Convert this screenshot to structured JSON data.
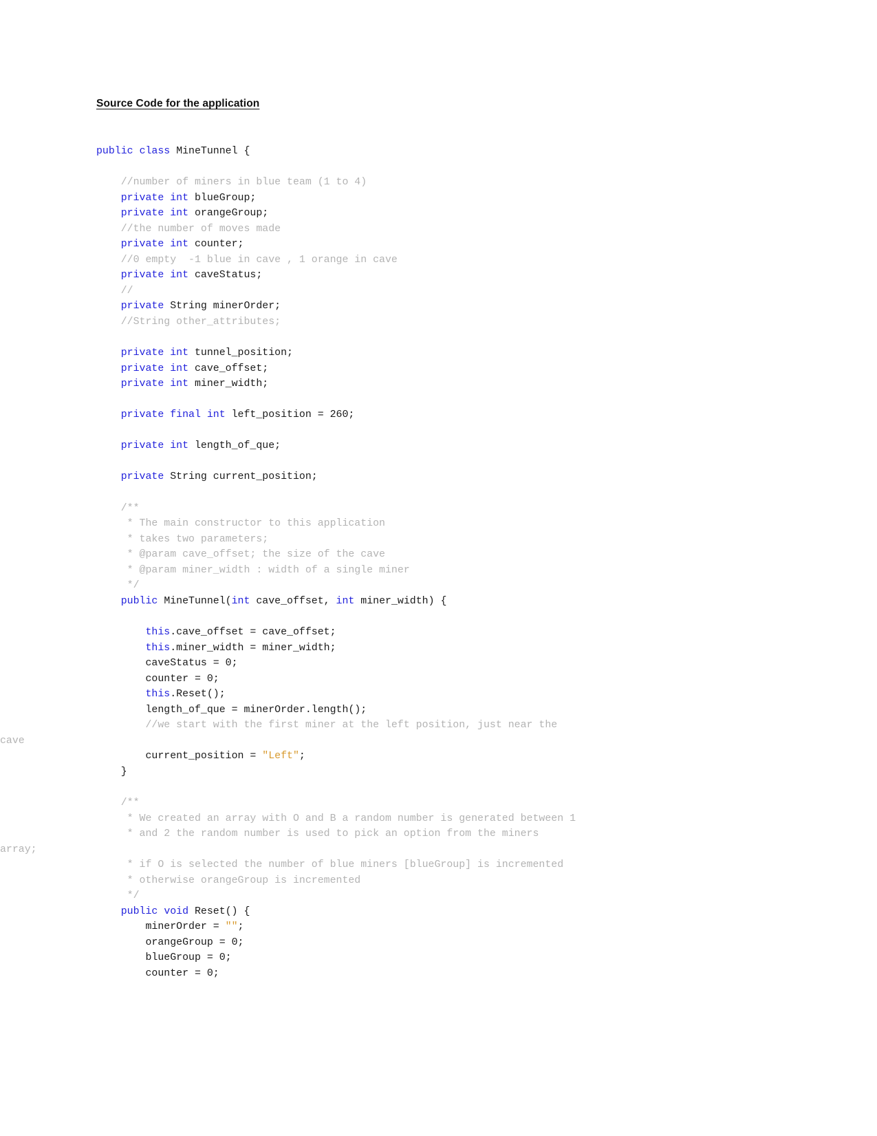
{
  "document": {
    "heading": "Source Code for the application",
    "language": "java",
    "colors": {
      "keyword": "#2323DC",
      "comment": "#B3B3B3",
      "string": "#D89A2E",
      "text": "#1A1A1A",
      "background": "#FFFFFF"
    },
    "code_lines": [
      {
        "id": "l1",
        "indent": 0,
        "wrapped": false,
        "tokens": [
          {
            "t": "public ",
            "c": "kw"
          },
          {
            "t": "class ",
            "c": "kw"
          },
          {
            "t": "MineTunnel {",
            "c": "plain"
          }
        ]
      },
      {
        "id": "l2",
        "indent": 0,
        "wrapped": false,
        "tokens": []
      },
      {
        "id": "l3",
        "indent": 1,
        "wrapped": false,
        "tokens": [
          {
            "t": "//number of miners in blue team (1 to 4)",
            "c": "cmt"
          }
        ]
      },
      {
        "id": "l4",
        "indent": 1,
        "wrapped": false,
        "tokens": [
          {
            "t": "private ",
            "c": "kw"
          },
          {
            "t": "int ",
            "c": "kw"
          },
          {
            "t": "blueGroup;",
            "c": "plain"
          }
        ]
      },
      {
        "id": "l5",
        "indent": 1,
        "wrapped": false,
        "tokens": [
          {
            "t": "private ",
            "c": "kw"
          },
          {
            "t": "int ",
            "c": "kw"
          },
          {
            "t": "orangeGroup;",
            "c": "plain"
          }
        ]
      },
      {
        "id": "l6",
        "indent": 1,
        "wrapped": false,
        "tokens": [
          {
            "t": "//the number of moves made",
            "c": "cmt"
          }
        ]
      },
      {
        "id": "l7",
        "indent": 1,
        "wrapped": false,
        "tokens": [
          {
            "t": "private ",
            "c": "kw"
          },
          {
            "t": "int ",
            "c": "kw"
          },
          {
            "t": "counter;",
            "c": "plain"
          }
        ]
      },
      {
        "id": "l8",
        "indent": 1,
        "wrapped": false,
        "tokens": [
          {
            "t": "//0 empty  -1 blue in cave , 1 orange in cave",
            "c": "cmt"
          }
        ]
      },
      {
        "id": "l9",
        "indent": 1,
        "wrapped": false,
        "tokens": [
          {
            "t": "private ",
            "c": "kw"
          },
          {
            "t": "int ",
            "c": "kw"
          },
          {
            "t": "caveStatus;",
            "c": "plain"
          }
        ]
      },
      {
        "id": "l10",
        "indent": 1,
        "wrapped": false,
        "tokens": [
          {
            "t": "//",
            "c": "cmt"
          }
        ]
      },
      {
        "id": "l11",
        "indent": 1,
        "wrapped": false,
        "tokens": [
          {
            "t": "private ",
            "c": "kw"
          },
          {
            "t": "String minerOrder;",
            "c": "plain"
          }
        ]
      },
      {
        "id": "l12",
        "indent": 1,
        "wrapped": false,
        "tokens": [
          {
            "t": "//String other_attributes;",
            "c": "cmt"
          }
        ]
      },
      {
        "id": "l13",
        "indent": 0,
        "wrapped": false,
        "tokens": []
      },
      {
        "id": "l14",
        "indent": 1,
        "wrapped": false,
        "tokens": [
          {
            "t": "private ",
            "c": "kw"
          },
          {
            "t": "int ",
            "c": "kw"
          },
          {
            "t": "tunnel_position;",
            "c": "plain"
          }
        ]
      },
      {
        "id": "l15",
        "indent": 1,
        "wrapped": false,
        "tokens": [
          {
            "t": "private ",
            "c": "kw"
          },
          {
            "t": "int ",
            "c": "kw"
          },
          {
            "t": "cave_offset;",
            "c": "plain"
          }
        ]
      },
      {
        "id": "l16",
        "indent": 1,
        "wrapped": false,
        "tokens": [
          {
            "t": "private ",
            "c": "kw"
          },
          {
            "t": "int ",
            "c": "kw"
          },
          {
            "t": "miner_width;",
            "c": "plain"
          }
        ]
      },
      {
        "id": "l17",
        "indent": 0,
        "wrapped": false,
        "tokens": []
      },
      {
        "id": "l18",
        "indent": 1,
        "wrapped": false,
        "tokens": [
          {
            "t": "private ",
            "c": "kw"
          },
          {
            "t": "final ",
            "c": "kw"
          },
          {
            "t": "int ",
            "c": "kw"
          },
          {
            "t": "left_position = 260;",
            "c": "plain"
          }
        ]
      },
      {
        "id": "l19",
        "indent": 0,
        "wrapped": false,
        "tokens": []
      },
      {
        "id": "l20",
        "indent": 1,
        "wrapped": false,
        "tokens": [
          {
            "t": "private ",
            "c": "kw"
          },
          {
            "t": "int ",
            "c": "kw"
          },
          {
            "t": "length_of_que;",
            "c": "plain"
          }
        ]
      },
      {
        "id": "l21",
        "indent": 0,
        "wrapped": false,
        "tokens": []
      },
      {
        "id": "l22",
        "indent": 1,
        "wrapped": false,
        "tokens": [
          {
            "t": "private ",
            "c": "kw"
          },
          {
            "t": "String current_position;",
            "c": "plain"
          }
        ]
      },
      {
        "id": "l23",
        "indent": 0,
        "wrapped": false,
        "tokens": []
      },
      {
        "id": "l24",
        "indent": 1,
        "wrapped": false,
        "tokens": [
          {
            "t": "/**",
            "c": "cmt"
          }
        ]
      },
      {
        "id": "l25",
        "indent": 1,
        "wrapped": false,
        "tokens": [
          {
            "t": " * The main constructor to this application",
            "c": "cmt"
          }
        ]
      },
      {
        "id": "l26",
        "indent": 1,
        "wrapped": false,
        "tokens": [
          {
            "t": " * takes two parameters;",
            "c": "cmt"
          }
        ]
      },
      {
        "id": "l27",
        "indent": 1,
        "wrapped": false,
        "tokens": [
          {
            "t": " * @param cave_offset; the size of the cave",
            "c": "cmt"
          }
        ]
      },
      {
        "id": "l28",
        "indent": 1,
        "wrapped": false,
        "tokens": [
          {
            "t": " * @param miner_width : width of a single miner",
            "c": "cmt"
          }
        ]
      },
      {
        "id": "l29",
        "indent": 1,
        "wrapped": false,
        "tokens": [
          {
            "t": " */",
            "c": "cmt"
          }
        ]
      },
      {
        "id": "l30",
        "indent": 1,
        "wrapped": false,
        "tokens": [
          {
            "t": "public ",
            "c": "kw"
          },
          {
            "t": "MineTunnel(",
            "c": "plain"
          },
          {
            "t": "int ",
            "c": "kw"
          },
          {
            "t": "cave_offset, ",
            "c": "plain"
          },
          {
            "t": "int ",
            "c": "kw"
          },
          {
            "t": "miner_width) {",
            "c": "plain"
          }
        ]
      },
      {
        "id": "l31",
        "indent": 0,
        "wrapped": false,
        "tokens": []
      },
      {
        "id": "l32",
        "indent": 2,
        "wrapped": false,
        "tokens": [
          {
            "t": "this",
            "c": "kw"
          },
          {
            "t": ".cave_offset = cave_offset;",
            "c": "plain"
          }
        ]
      },
      {
        "id": "l33",
        "indent": 2,
        "wrapped": false,
        "tokens": [
          {
            "t": "this",
            "c": "kw"
          },
          {
            "t": ".miner_width = miner_width;",
            "c": "plain"
          }
        ]
      },
      {
        "id": "l34",
        "indent": 2,
        "wrapped": false,
        "tokens": [
          {
            "t": "caveStatus = 0;",
            "c": "plain"
          }
        ]
      },
      {
        "id": "l35",
        "indent": 2,
        "wrapped": false,
        "tokens": [
          {
            "t": "counter = 0;",
            "c": "plain"
          }
        ]
      },
      {
        "id": "l36",
        "indent": 2,
        "wrapped": false,
        "tokens": [
          {
            "t": "this",
            "c": "kw"
          },
          {
            "t": ".Reset();",
            "c": "plain"
          }
        ]
      },
      {
        "id": "l37",
        "indent": 2,
        "wrapped": false,
        "tokens": [
          {
            "t": "length_of_que = minerOrder.length();",
            "c": "plain"
          }
        ]
      },
      {
        "id": "l38",
        "indent": 2,
        "wrapped": false,
        "tokens": [
          {
            "t": "//we start with the first miner at the left position, just near the",
            "c": "cmt"
          }
        ]
      },
      {
        "id": "l39",
        "indent": 0,
        "wrapped": true,
        "tokens": [
          {
            "t": "cave",
            "c": "cmt"
          }
        ]
      },
      {
        "id": "l40",
        "indent": 2,
        "wrapped": false,
        "tokens": [
          {
            "t": "current_position = ",
            "c": "plain"
          },
          {
            "t": "\"Left\"",
            "c": "str"
          },
          {
            "t": ";",
            "c": "plain"
          }
        ]
      },
      {
        "id": "l41",
        "indent": 1,
        "wrapped": false,
        "tokens": [
          {
            "t": "}",
            "c": "plain"
          }
        ]
      },
      {
        "id": "l42",
        "indent": 0,
        "wrapped": false,
        "tokens": []
      },
      {
        "id": "l43",
        "indent": 1,
        "wrapped": false,
        "tokens": [
          {
            "t": "/**",
            "c": "cmt"
          }
        ]
      },
      {
        "id": "l44",
        "indent": 1,
        "wrapped": false,
        "tokens": [
          {
            "t": " * We created an array with O and B a random number is generated between 1",
            "c": "cmt"
          }
        ]
      },
      {
        "id": "l45",
        "indent": 1,
        "wrapped": false,
        "tokens": [
          {
            "t": " * and 2 the random number is used to pick an option from the miners",
            "c": "cmt"
          }
        ]
      },
      {
        "id": "l46",
        "indent": 0,
        "wrapped": true,
        "tokens": [
          {
            "t": "array;",
            "c": "cmt"
          }
        ]
      },
      {
        "id": "l47",
        "indent": 1,
        "wrapped": false,
        "tokens": [
          {
            "t": " * if O is selected the number of blue miners [blueGroup] is incremented",
            "c": "cmt"
          }
        ]
      },
      {
        "id": "l48",
        "indent": 1,
        "wrapped": false,
        "tokens": [
          {
            "t": " * otherwise orangeGroup is incremented",
            "c": "cmt"
          }
        ]
      },
      {
        "id": "l49",
        "indent": 1,
        "wrapped": false,
        "tokens": [
          {
            "t": " */",
            "c": "cmt"
          }
        ]
      },
      {
        "id": "l50",
        "indent": 1,
        "wrapped": false,
        "tokens": [
          {
            "t": "public ",
            "c": "kw"
          },
          {
            "t": "void ",
            "c": "kw"
          },
          {
            "t": "Reset() {",
            "c": "plain"
          }
        ]
      },
      {
        "id": "l51",
        "indent": 2,
        "wrapped": false,
        "tokens": [
          {
            "t": "minerOrder = ",
            "c": "plain"
          },
          {
            "t": "\"\"",
            "c": "str"
          },
          {
            "t": ";",
            "c": "plain"
          }
        ]
      },
      {
        "id": "l52",
        "indent": 2,
        "wrapped": false,
        "tokens": [
          {
            "t": "orangeGroup = 0;",
            "c": "plain"
          }
        ]
      },
      {
        "id": "l53",
        "indent": 2,
        "wrapped": false,
        "tokens": [
          {
            "t": "blueGroup = 0;",
            "c": "plain"
          }
        ]
      },
      {
        "id": "l54",
        "indent": 2,
        "wrapped": false,
        "tokens": [
          {
            "t": "counter = 0;",
            "c": "plain"
          }
        ]
      }
    ]
  }
}
